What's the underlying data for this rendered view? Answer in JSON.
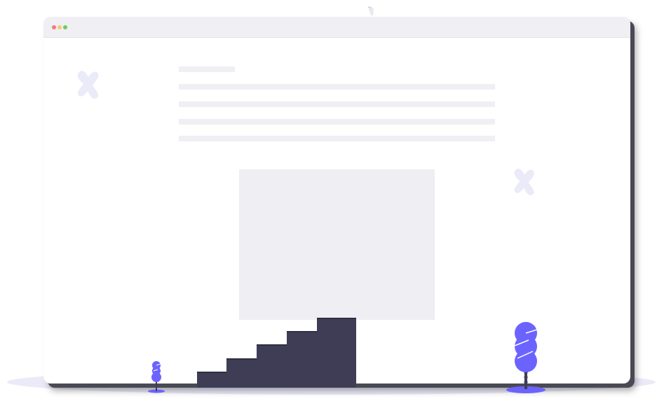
{
  "window": {
    "controls": [
      {
        "name": "close",
        "color": "#f27a7a"
      },
      {
        "name": "minimize",
        "color": "#f2cf6a"
      },
      {
        "name": "maximize",
        "color": "#6ccd63"
      }
    ]
  },
  "colors": {
    "placeholder": "#efeff4",
    "accent": "#6c63ff",
    "dark": "#3f3d56",
    "decoration": "#ebeaf8"
  },
  "icons": {
    "decoration_left": "x-mark-icon",
    "decoration_right": "x-mark-icon",
    "small_tree": "tree-icon",
    "large_tree": "tree-icon",
    "staircase": "stairs-icon"
  }
}
